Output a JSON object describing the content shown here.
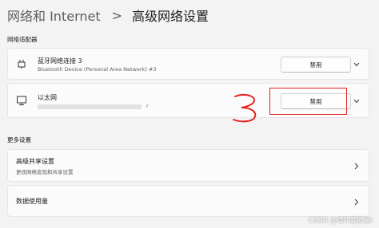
{
  "breadcrumb": {
    "parent": "网络和 Internet",
    "separator": ">",
    "current": "高级网络设置"
  },
  "sections": {
    "adapters_title": "网络适配器",
    "more_title": "更多设置"
  },
  "adapters": [
    {
      "name": "蓝牙网络连接 3",
      "description": "Bluetooth Device (Personal Area Network) #3",
      "button_label": "禁用",
      "icon": "network-adapter-icon"
    },
    {
      "name": "以太网",
      "description": "r",
      "button_label": "禁用",
      "icon": "ethernet-icon"
    }
  ],
  "more_settings": [
    {
      "title": "高级共享设置",
      "subtitle": "更改网络发现和共享设置"
    },
    {
      "title": "数据使用量",
      "subtitle": ""
    }
  ],
  "annotation": {
    "number": "3",
    "color": "#e52121"
  },
  "watermark": "CSDN @请叫我欧皇i"
}
